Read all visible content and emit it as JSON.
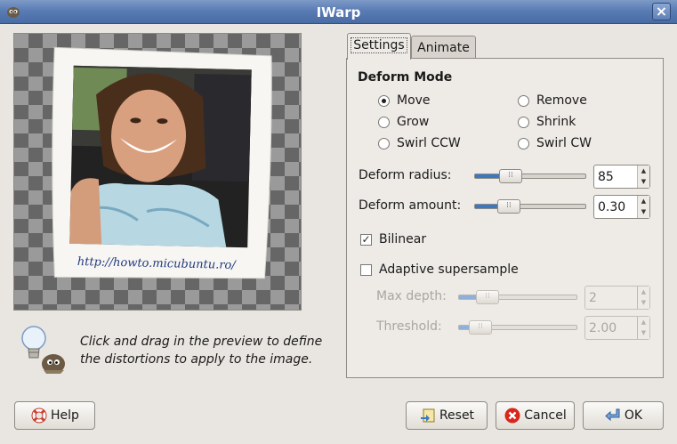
{
  "window": {
    "title": "IWarp"
  },
  "preview": {
    "url_text": "http://howto.micubuntu.ro/"
  },
  "hint": {
    "text": "Click and drag in the preview to define the distortions to apply to the image."
  },
  "tabs": [
    {
      "label": "Settings",
      "active": true
    },
    {
      "label": "Animate",
      "active": false
    }
  ],
  "deform_mode": {
    "heading": "Deform Mode",
    "options": [
      {
        "label": "Move",
        "selected": true
      },
      {
        "label": "Remove",
        "selected": false
      },
      {
        "label": "Grow",
        "selected": false
      },
      {
        "label": "Shrink",
        "selected": false
      },
      {
        "label": "Swirl CCW",
        "selected": false
      },
      {
        "label": "Swirl CW",
        "selected": false
      }
    ]
  },
  "sliders": {
    "deform_radius": {
      "label": "Deform radius:",
      "value": "85",
      "fraction": 0.28
    },
    "deform_amount": {
      "label": "Deform amount:",
      "value": "0.30",
      "fraction": 0.25
    },
    "max_depth": {
      "label": "Max depth:",
      "value": "2",
      "fraction": 0.18,
      "enabled": false
    },
    "threshold": {
      "label": "Threshold:",
      "value": "2.00",
      "fraction": 0.1,
      "enabled": false
    }
  },
  "checkboxes": {
    "bilinear": {
      "label": "Bilinear",
      "checked": true
    },
    "adaptive": {
      "label": "Adaptive supersample",
      "checked": false
    }
  },
  "buttons": {
    "help": "Help",
    "reset": "Reset",
    "cancel": "Cancel",
    "ok": "OK"
  },
  "colors": {
    "titlebar": "#5a7cb4",
    "accent": "#3b78c3",
    "background": "#e9e6e1"
  }
}
